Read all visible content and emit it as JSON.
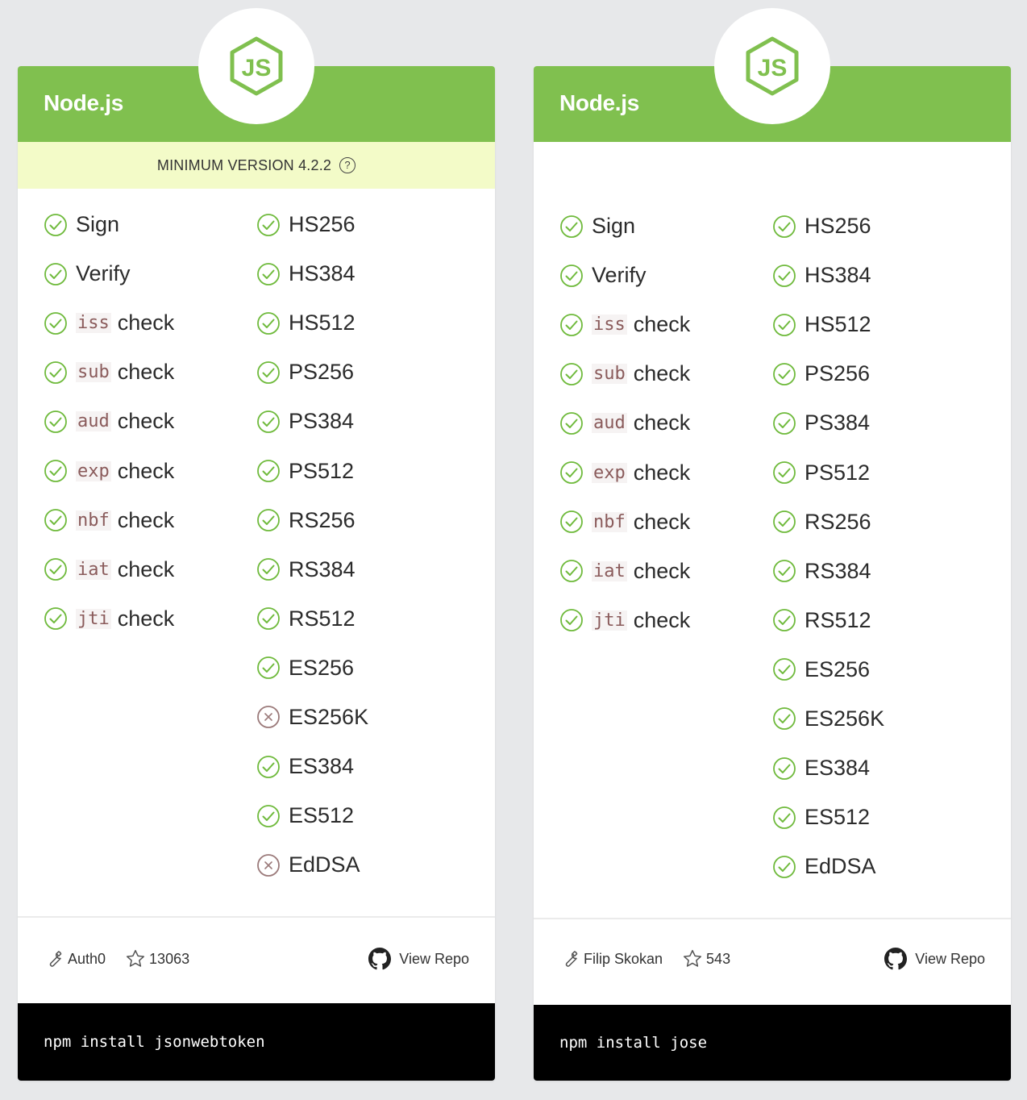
{
  "colors": {
    "green": "#80c04f",
    "check": "#6fba3c",
    "cross": "#9b7a7a",
    "banner": "#f3fbc8"
  },
  "cards": [
    {
      "title": "Node.js",
      "logo_icon": "nodejs-logo-icon",
      "min_version": "MINIMUM VERSION 4.2.2",
      "features": [
        {
          "code": "",
          "label": "Sign",
          "supported": true
        },
        {
          "code": "",
          "label": "Verify",
          "supported": true
        },
        {
          "code": "iss",
          "label": "check",
          "supported": true
        },
        {
          "code": "sub",
          "label": "check",
          "supported": true
        },
        {
          "code": "aud",
          "label": "check",
          "supported": true
        },
        {
          "code": "exp",
          "label": "check",
          "supported": true
        },
        {
          "code": "nbf",
          "label": "check",
          "supported": true
        },
        {
          "code": "iat",
          "label": "check",
          "supported": true
        },
        {
          "code": "jti",
          "label": "check",
          "supported": true
        }
      ],
      "algorithms": [
        {
          "label": "HS256",
          "supported": true
        },
        {
          "label": "HS384",
          "supported": true
        },
        {
          "label": "HS512",
          "supported": true
        },
        {
          "label": "PS256",
          "supported": true
        },
        {
          "label": "PS384",
          "supported": true
        },
        {
          "label": "PS512",
          "supported": true
        },
        {
          "label": "RS256",
          "supported": true
        },
        {
          "label": "RS384",
          "supported": true
        },
        {
          "label": "RS512",
          "supported": true
        },
        {
          "label": "ES256",
          "supported": true
        },
        {
          "label": "ES256K",
          "supported": false
        },
        {
          "label": "ES384",
          "supported": true
        },
        {
          "label": "ES512",
          "supported": true
        },
        {
          "label": "EdDSA",
          "supported": false
        }
      ],
      "author": "Auth0",
      "stars": "13063",
      "repo_label": "View Repo",
      "install": "npm install jsonwebtoken"
    },
    {
      "title": "Node.js",
      "logo_icon": "nodejs-logo-icon",
      "min_version": "",
      "features": [
        {
          "code": "",
          "label": "Sign",
          "supported": true
        },
        {
          "code": "",
          "label": "Verify",
          "supported": true
        },
        {
          "code": "iss",
          "label": "check",
          "supported": true
        },
        {
          "code": "sub",
          "label": "check",
          "supported": true
        },
        {
          "code": "aud",
          "label": "check",
          "supported": true
        },
        {
          "code": "exp",
          "label": "check",
          "supported": true
        },
        {
          "code": "nbf",
          "label": "check",
          "supported": true
        },
        {
          "code": "iat",
          "label": "check",
          "supported": true
        },
        {
          "code": "jti",
          "label": "check",
          "supported": true
        }
      ],
      "algorithms": [
        {
          "label": "HS256",
          "supported": true
        },
        {
          "label": "HS384",
          "supported": true
        },
        {
          "label": "HS512",
          "supported": true
        },
        {
          "label": "PS256",
          "supported": true
        },
        {
          "label": "PS384",
          "supported": true
        },
        {
          "label": "PS512",
          "supported": true
        },
        {
          "label": "RS256",
          "supported": true
        },
        {
          "label": "RS384",
          "supported": true
        },
        {
          "label": "RS512",
          "supported": true
        },
        {
          "label": "ES256",
          "supported": true
        },
        {
          "label": "ES256K",
          "supported": true
        },
        {
          "label": "ES384",
          "supported": true
        },
        {
          "label": "ES512",
          "supported": true
        },
        {
          "label": "EdDSA",
          "supported": true
        }
      ],
      "author": "Filip Skokan",
      "stars": "543",
      "repo_label": "View Repo",
      "install": "npm install jose"
    }
  ]
}
